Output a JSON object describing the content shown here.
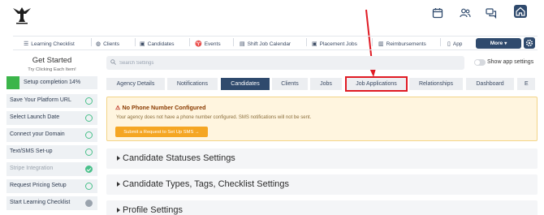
{
  "header": {
    "logo_icon": "eagle-logo-icon",
    "icons": [
      "calendar-icon",
      "users-icon",
      "chat-icon",
      "home-icon"
    ]
  },
  "nav": {
    "items": [
      {
        "label": "Learning Checklist",
        "icon": "list-icon"
      },
      {
        "label": "Clients",
        "icon": "globe-icon"
      },
      {
        "label": "Candidates",
        "icon": "briefcase-icon"
      },
      {
        "label": "Events",
        "icon": "pin-icon"
      },
      {
        "label": "Shift Job Calendar",
        "icon": "calendar-icon"
      },
      {
        "label": "Placement Jobs",
        "icon": "briefcase-icon"
      },
      {
        "label": "Reimbursements",
        "icon": "receipt-icon"
      },
      {
        "label": "App",
        "icon": "phone-icon"
      }
    ],
    "more_label": "More",
    "more_caret": "▾",
    "settings_icon": "gear-icon"
  },
  "sidebar": {
    "title": "Get Started",
    "subtitle": "Try Clicking Each Item!",
    "progress_label": "Setup completion 14%",
    "progress_percent": 14,
    "items": [
      {
        "label": "Save Your Platform URL",
        "status": "pending"
      },
      {
        "label": "Select Launch Date",
        "status": "pending"
      },
      {
        "label": "Connect your Domain",
        "status": "pending"
      },
      {
        "label": "Text/SMS Set-up",
        "status": "pending"
      },
      {
        "label": "Stripe Integration",
        "status": "done"
      },
      {
        "label": "Request Pricing Setup",
        "status": "pending"
      },
      {
        "label": "Start Learning Checklist",
        "status": "partial"
      }
    ]
  },
  "search": {
    "placeholder": "Search Settings",
    "value": ""
  },
  "toggle": {
    "label": "Show app settings",
    "on": false
  },
  "tabs": [
    {
      "label": "Agency Details",
      "active": false
    },
    {
      "label": "Notifications",
      "active": false
    },
    {
      "label": "Candidates",
      "active": true
    },
    {
      "label": "Clients",
      "active": false
    },
    {
      "label": "Jobs",
      "active": false
    },
    {
      "label": "Job Applications",
      "active": false,
      "highlighted": true
    },
    {
      "label": "Relationships",
      "active": false
    },
    {
      "label": "Dashboard",
      "active": false
    },
    {
      "label": "E",
      "active": false
    }
  ],
  "alert": {
    "icon": "warning-icon",
    "title": "No Phone Number Configured",
    "text": "Your agency does not have a phone number configured. SMS notifications will not be sent.",
    "button_label": "Submit a Request to Set Up SMS →"
  },
  "sections": [
    {
      "title": "Candidate Statuses Settings"
    },
    {
      "title": "Candidate Types, Tags, Checklist Settings"
    },
    {
      "title": "Profile Settings"
    }
  ],
  "colors": {
    "primary": "#2f4a6d",
    "success": "#3bb54a",
    "warning": "#f5a623",
    "annotation": "#e01b24"
  }
}
